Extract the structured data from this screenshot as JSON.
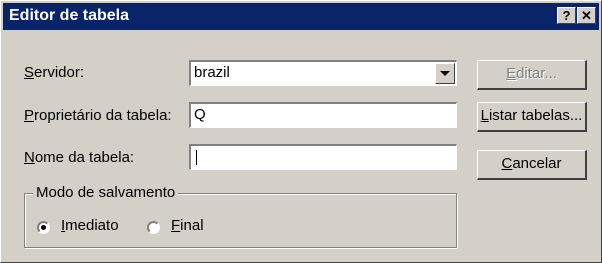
{
  "window": {
    "title": "Editor de tabela",
    "help_btn": "?",
    "close_btn": "✕"
  },
  "form": {
    "server_label_u": "S",
    "server_label_rest": "ervidor:",
    "server_value": "brazil",
    "owner_label_u": "P",
    "owner_label_rest": "roprietário da tabela:",
    "owner_value": "Q",
    "table_label_u": "N",
    "table_label_rest": "ome da tabela:",
    "table_value": ""
  },
  "buttons": {
    "edit_u": "E",
    "edit_rest": "ditar...",
    "list_u": "L",
    "list_rest": "istar tabelas...",
    "cancel_u": "C",
    "cancel_rest": "ancelar"
  },
  "save_mode": {
    "group_label": "Modo de salvamento",
    "opt1_u": "I",
    "opt1_rest": "mediato",
    "opt1_selected": true,
    "opt2_u": "F",
    "opt2_rest": "inal",
    "opt2_selected": false
  }
}
